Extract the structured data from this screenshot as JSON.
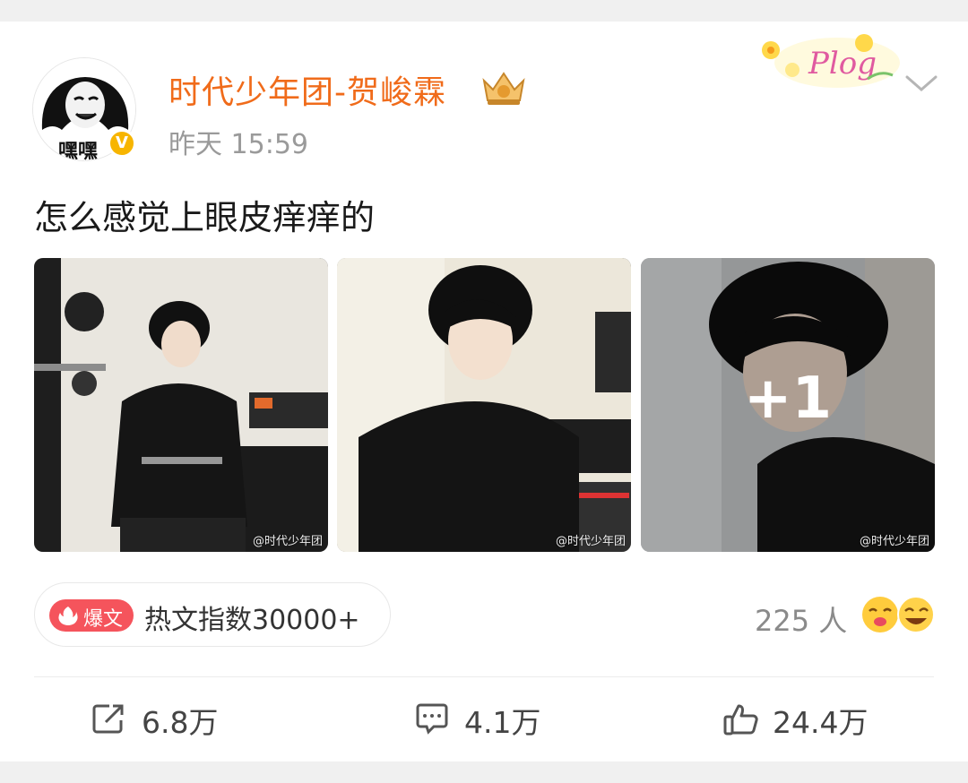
{
  "post": {
    "avatar_label": "嘿嘿",
    "username": "时代少年团-贺峻霖",
    "timestamp": "昨天 15:59",
    "text": "怎么感觉上眼皮痒痒的",
    "sticker_text": "Plog",
    "photos": [
      {
        "watermark": "@时代少年团"
      },
      {
        "watermark": "@时代少年团"
      },
      {
        "watermark": "@时代少年团",
        "more_count": "+1"
      }
    ]
  },
  "hot": {
    "badge_label": "爆文",
    "index_label": "热文指数30000+"
  },
  "reactions": {
    "count": "225 人"
  },
  "actions": {
    "share_count": "6.8万",
    "comment_count": "4.1万",
    "like_count": "24.4万"
  },
  "colors": {
    "username": "#f06b1a",
    "hot_badge": "#f5545c",
    "verified": "#f7b500"
  }
}
